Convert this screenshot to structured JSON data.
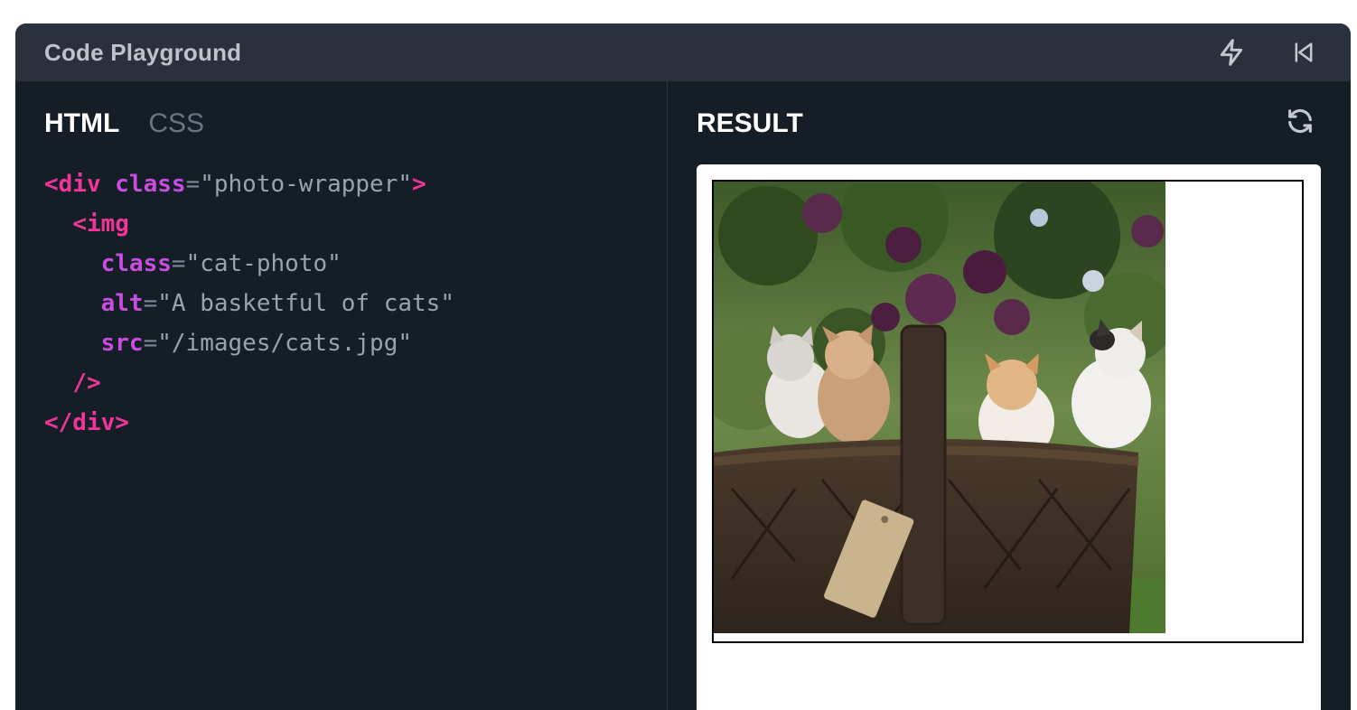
{
  "window": {
    "title": "Code Playground",
    "actions": [
      {
        "name": "lightning-icon"
      },
      {
        "name": "skip-back-icon"
      }
    ]
  },
  "editor": {
    "tabs": [
      {
        "label": "HTML",
        "active": true
      },
      {
        "label": "CSS",
        "active": false
      }
    ],
    "code": {
      "l1_open": "<div",
      "l1_attr": "class",
      "l1_eq": "=",
      "l1_val": "\"photo-wrapper\"",
      "l1_close": ">",
      "l2_tag": "<img",
      "l3_attr": "class",
      "l3_eq": "=",
      "l3_val": "\"cat-photo\"",
      "l4_attr": "alt",
      "l4_eq": "=",
      "l4_val": "\"A basketful of cats\"",
      "l5_attr": "src",
      "l5_eq": "=",
      "l5_val": "\"/images/cats.jpg\"",
      "l6_close": "/>",
      "l7_close": "</div>"
    }
  },
  "result": {
    "header": "RESULT",
    "refresh_icon": "refresh-icon",
    "image_alt": "A basketful of cats"
  }
}
